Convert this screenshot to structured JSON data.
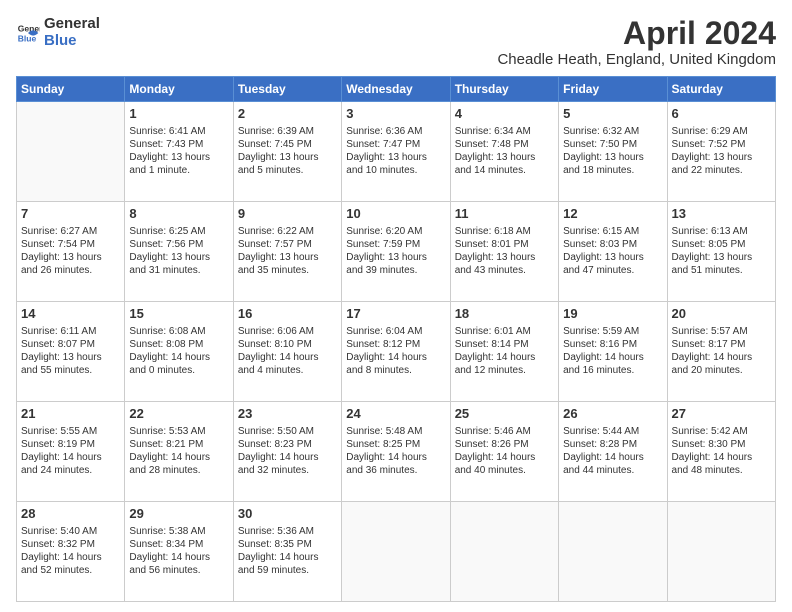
{
  "header": {
    "logo_general": "General",
    "logo_blue": "Blue",
    "month_title": "April 2024",
    "location": "Cheadle Heath, England, United Kingdom"
  },
  "days_of_week": [
    "Sunday",
    "Monday",
    "Tuesday",
    "Wednesday",
    "Thursday",
    "Friday",
    "Saturday"
  ],
  "weeks": [
    [
      {
        "day": "",
        "info": ""
      },
      {
        "day": "1",
        "info": "Sunrise: 6:41 AM\nSunset: 7:43 PM\nDaylight: 13 hours\nand 1 minute."
      },
      {
        "day": "2",
        "info": "Sunrise: 6:39 AM\nSunset: 7:45 PM\nDaylight: 13 hours\nand 5 minutes."
      },
      {
        "day": "3",
        "info": "Sunrise: 6:36 AM\nSunset: 7:47 PM\nDaylight: 13 hours\nand 10 minutes."
      },
      {
        "day": "4",
        "info": "Sunrise: 6:34 AM\nSunset: 7:48 PM\nDaylight: 13 hours\nand 14 minutes."
      },
      {
        "day": "5",
        "info": "Sunrise: 6:32 AM\nSunset: 7:50 PM\nDaylight: 13 hours\nand 18 minutes."
      },
      {
        "day": "6",
        "info": "Sunrise: 6:29 AM\nSunset: 7:52 PM\nDaylight: 13 hours\nand 22 minutes."
      }
    ],
    [
      {
        "day": "7",
        "info": "Sunrise: 6:27 AM\nSunset: 7:54 PM\nDaylight: 13 hours\nand 26 minutes."
      },
      {
        "day": "8",
        "info": "Sunrise: 6:25 AM\nSunset: 7:56 PM\nDaylight: 13 hours\nand 31 minutes."
      },
      {
        "day": "9",
        "info": "Sunrise: 6:22 AM\nSunset: 7:57 PM\nDaylight: 13 hours\nand 35 minutes."
      },
      {
        "day": "10",
        "info": "Sunrise: 6:20 AM\nSunset: 7:59 PM\nDaylight: 13 hours\nand 39 minutes."
      },
      {
        "day": "11",
        "info": "Sunrise: 6:18 AM\nSunset: 8:01 PM\nDaylight: 13 hours\nand 43 minutes."
      },
      {
        "day": "12",
        "info": "Sunrise: 6:15 AM\nSunset: 8:03 PM\nDaylight: 13 hours\nand 47 minutes."
      },
      {
        "day": "13",
        "info": "Sunrise: 6:13 AM\nSunset: 8:05 PM\nDaylight: 13 hours\nand 51 minutes."
      }
    ],
    [
      {
        "day": "14",
        "info": "Sunrise: 6:11 AM\nSunset: 8:07 PM\nDaylight: 13 hours\nand 55 minutes."
      },
      {
        "day": "15",
        "info": "Sunrise: 6:08 AM\nSunset: 8:08 PM\nDaylight: 14 hours\nand 0 minutes."
      },
      {
        "day": "16",
        "info": "Sunrise: 6:06 AM\nSunset: 8:10 PM\nDaylight: 14 hours\nand 4 minutes."
      },
      {
        "day": "17",
        "info": "Sunrise: 6:04 AM\nSunset: 8:12 PM\nDaylight: 14 hours\nand 8 minutes."
      },
      {
        "day": "18",
        "info": "Sunrise: 6:01 AM\nSunset: 8:14 PM\nDaylight: 14 hours\nand 12 minutes."
      },
      {
        "day": "19",
        "info": "Sunrise: 5:59 AM\nSunset: 8:16 PM\nDaylight: 14 hours\nand 16 minutes."
      },
      {
        "day": "20",
        "info": "Sunrise: 5:57 AM\nSunset: 8:17 PM\nDaylight: 14 hours\nand 20 minutes."
      }
    ],
    [
      {
        "day": "21",
        "info": "Sunrise: 5:55 AM\nSunset: 8:19 PM\nDaylight: 14 hours\nand 24 minutes."
      },
      {
        "day": "22",
        "info": "Sunrise: 5:53 AM\nSunset: 8:21 PM\nDaylight: 14 hours\nand 28 minutes."
      },
      {
        "day": "23",
        "info": "Sunrise: 5:50 AM\nSunset: 8:23 PM\nDaylight: 14 hours\nand 32 minutes."
      },
      {
        "day": "24",
        "info": "Sunrise: 5:48 AM\nSunset: 8:25 PM\nDaylight: 14 hours\nand 36 minutes."
      },
      {
        "day": "25",
        "info": "Sunrise: 5:46 AM\nSunset: 8:26 PM\nDaylight: 14 hours\nand 40 minutes."
      },
      {
        "day": "26",
        "info": "Sunrise: 5:44 AM\nSunset: 8:28 PM\nDaylight: 14 hours\nand 44 minutes."
      },
      {
        "day": "27",
        "info": "Sunrise: 5:42 AM\nSunset: 8:30 PM\nDaylight: 14 hours\nand 48 minutes."
      }
    ],
    [
      {
        "day": "28",
        "info": "Sunrise: 5:40 AM\nSunset: 8:32 PM\nDaylight: 14 hours\nand 52 minutes."
      },
      {
        "day": "29",
        "info": "Sunrise: 5:38 AM\nSunset: 8:34 PM\nDaylight: 14 hours\nand 56 minutes."
      },
      {
        "day": "30",
        "info": "Sunrise: 5:36 AM\nSunset: 8:35 PM\nDaylight: 14 hours\nand 59 minutes."
      },
      {
        "day": "",
        "info": ""
      },
      {
        "day": "",
        "info": ""
      },
      {
        "day": "",
        "info": ""
      },
      {
        "day": "",
        "info": ""
      }
    ]
  ]
}
